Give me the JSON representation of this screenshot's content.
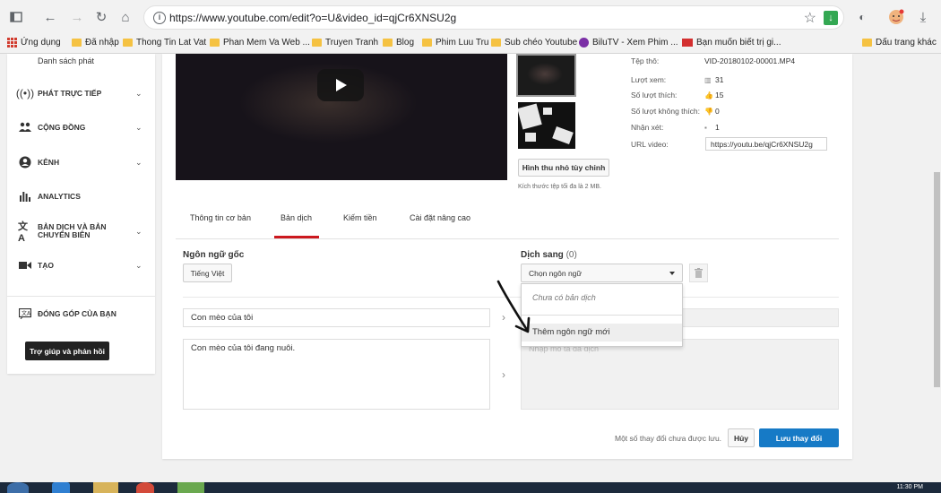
{
  "browser": {
    "url": "https://www.youtube.com/edit?o=U&video_id=qjCr6XNSU2g",
    "bookmarks": [
      "Ứng dụng",
      "Đã nhập",
      "Thong Tin Lat Vat",
      "Phan Mem Va Web ...",
      "Truyen Tranh",
      "Blog",
      "Phim Luu Tru",
      "Sub chéo Youtube",
      "BiluTV - Xem Phim ...",
      "Bạn muốn biết trị gi...",
      "Dấu trang khác"
    ]
  },
  "sidebar": {
    "playlists_label": "Danh sách phát",
    "items": [
      {
        "label": "PHÁT TRỰC TIẾP",
        "icon": "live-icon"
      },
      {
        "label": "CỘNG ĐỒNG",
        "icon": "community-icon"
      },
      {
        "label": "KÊNH",
        "icon": "channel-icon"
      },
      {
        "label": "ANALYTICS",
        "icon": "analytics-icon"
      },
      {
        "label": "BẢN DỊCH VÀ BẢN CHUYỂN BIÊN",
        "icon": "translate-icon"
      },
      {
        "label": "TẠO",
        "icon": "create-icon"
      },
      {
        "label": "ĐÓNG GÓP CỦA BẠN",
        "icon": "contribute-icon"
      }
    ],
    "help_button": "Trợ giúp và phản hồi"
  },
  "video_info": {
    "file_label": "Tệp thô:",
    "file_value": "VID-20180102-00001.MP4",
    "views_label": "Lượt xem:",
    "views_value": "31",
    "likes_label": "Số lượt thích:",
    "likes_value": "15",
    "dislikes_label": "Số lượt không thích:",
    "dislikes_value": "0",
    "comments_label": "Nhận xét:",
    "comments_value": "1",
    "url_label": "URL video:",
    "url_value": "https://youtu.be/qjCr6XNSU2g",
    "custom_thumb_button": "Hình thu nhỏ tùy chỉnh",
    "thumb_note": "Kích thước tệp tối đa là 2 MB."
  },
  "tabs": [
    "Thông tin cơ bản",
    "Bản dịch",
    "Kiếm tiền",
    "Cài đặt nâng cao"
  ],
  "translation": {
    "original_label": "Ngôn ngữ gốc",
    "original_button": "Tiếng Việt",
    "translate_label": "Dịch sang",
    "translate_count": "(0)",
    "select_placeholder": "Chọn ngôn ngữ",
    "dropdown_empty": "Chưa có bản dịch",
    "dropdown_add": "Thêm ngôn ngữ mới",
    "title_value": "Con mèo của tôi",
    "desc_value": "Con mèo của tôi đang nuôi.",
    "desc_placeholder": "Nhập mô tả đã dịch"
  },
  "footer": {
    "note": "Một số thay đổi chưa được lưu.",
    "cancel": "Hủy",
    "save": "Lưu thay đổi"
  },
  "taskbar": {
    "clock": "11:30 PM"
  },
  "colors": {
    "accent_red": "#cc181e",
    "save_blue": "#167ac6"
  }
}
